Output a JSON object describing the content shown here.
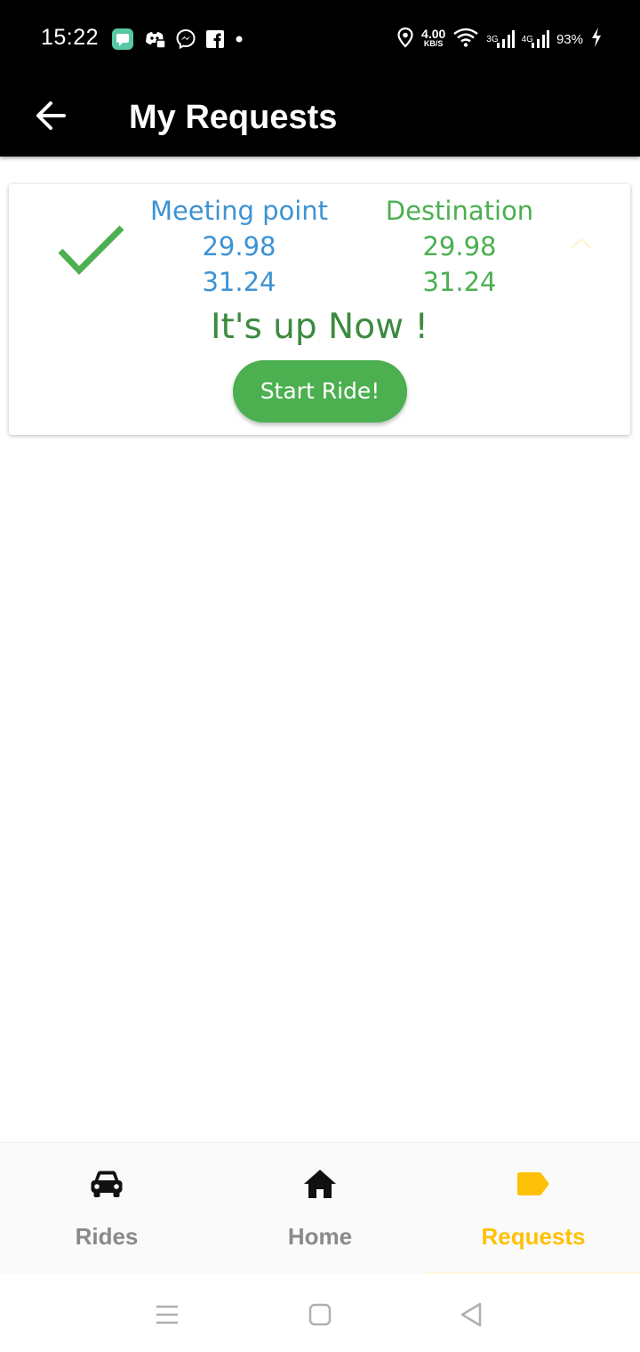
{
  "status_bar": {
    "time": "15:22",
    "net_speed_value": "4.00",
    "net_speed_unit": "KB/S",
    "signal_3g_label": "3G",
    "signal_4g_label": "4G",
    "battery_percent": "93%",
    "icons": [
      "messages-icon",
      "discord-icon",
      "messenger-icon",
      "facebook-icon",
      "dot-icon",
      "location-icon",
      "wifi-icon",
      "signal-3g-icon",
      "signal-4g-icon",
      "charging-icon"
    ]
  },
  "app_bar": {
    "title": "My Requests",
    "back_icon": "arrow-left-icon"
  },
  "request": {
    "status_icon": "check-icon",
    "meeting_point": {
      "label": "Meeting point",
      "lat": "29.98",
      "lng": "31.24"
    },
    "destination": {
      "label": "Destination",
      "lat": "29.98",
      "lng": "31.24"
    },
    "message": "It's up Now !",
    "action_label": "Start Ride!",
    "collapse_icon": "chevron-up-icon"
  },
  "bottom_nav": {
    "items": [
      {
        "label": "Rides",
        "icon": "car-icon",
        "active": false
      },
      {
        "label": "Home",
        "icon": "home-icon",
        "active": false
      },
      {
        "label": "Requests",
        "icon": "tag-icon",
        "active": true
      }
    ]
  },
  "system_nav": {
    "icons": [
      "menu-icon",
      "home-square-icon",
      "back-triangle-icon"
    ]
  },
  "colors": {
    "app_bar_bg": "#000000",
    "meeting_point": "#3d93d3",
    "destination": "#4caf50",
    "status_message": "#3c8a3f",
    "button_bg": "#4caf50",
    "active_nav": "#ffc107",
    "inactive_nav": "#8a8a8a"
  }
}
